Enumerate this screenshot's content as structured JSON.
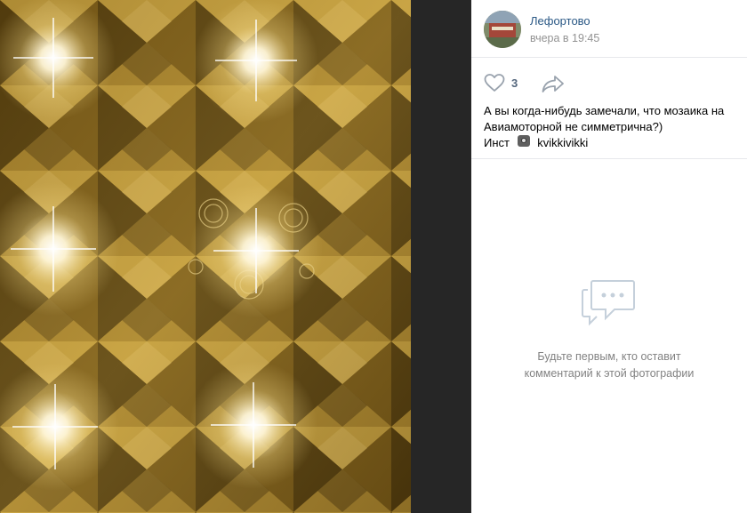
{
  "post": {
    "author": "Лефортово",
    "date": "вчера в 19:45",
    "likes": "3",
    "text_line1": "А вы когда-нибудь замечали, что мозаика на",
    "text_line2": "Авиамоторной не симметрична?)",
    "insta_prefix": "Инст",
    "insta_handle": "kvikkivikki"
  },
  "comments": {
    "empty_line1": "Будьте первым, кто оставит",
    "empty_line2": "комментарий к этой фотографии"
  },
  "icons": {
    "like": "heart-icon",
    "share": "share-arrow-icon",
    "camera": "camera-emoji",
    "comments": "speech-bubble-icon"
  },
  "colors": {
    "link": "#2a5885",
    "muted": "#939393",
    "icon": "#99a2ad",
    "photo_gold": "#b8902e"
  }
}
